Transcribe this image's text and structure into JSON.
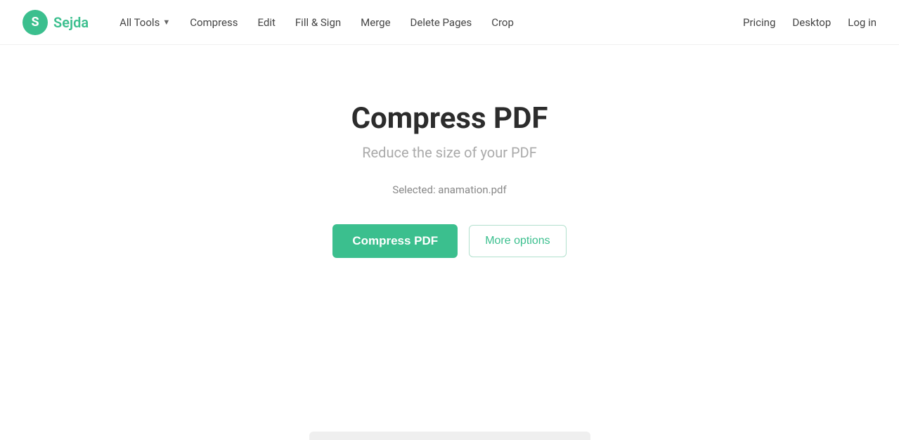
{
  "logo": {
    "icon_letter": "S",
    "text": "Sejda"
  },
  "nav": {
    "items": [
      {
        "id": "all-tools",
        "label": "All Tools",
        "has_chevron": true
      },
      {
        "id": "compress",
        "label": "Compress",
        "has_chevron": false
      },
      {
        "id": "edit",
        "label": "Edit",
        "has_chevron": false
      },
      {
        "id": "fill-sign",
        "label": "Fill & Sign",
        "has_chevron": false
      },
      {
        "id": "merge",
        "label": "Merge",
        "has_chevron": false
      },
      {
        "id": "delete-pages",
        "label": "Delete Pages",
        "has_chevron": false
      },
      {
        "id": "crop",
        "label": "Crop",
        "has_chevron": false
      }
    ]
  },
  "header_right": {
    "pricing": "Pricing",
    "desktop": "Desktop",
    "login": "Log in"
  },
  "main": {
    "title": "Compress PDF",
    "subtitle": "Reduce the size of your PDF",
    "selected_file_label": "Selected: anamation.pdf",
    "compress_btn": "Compress PDF",
    "more_options_btn": "More options"
  }
}
